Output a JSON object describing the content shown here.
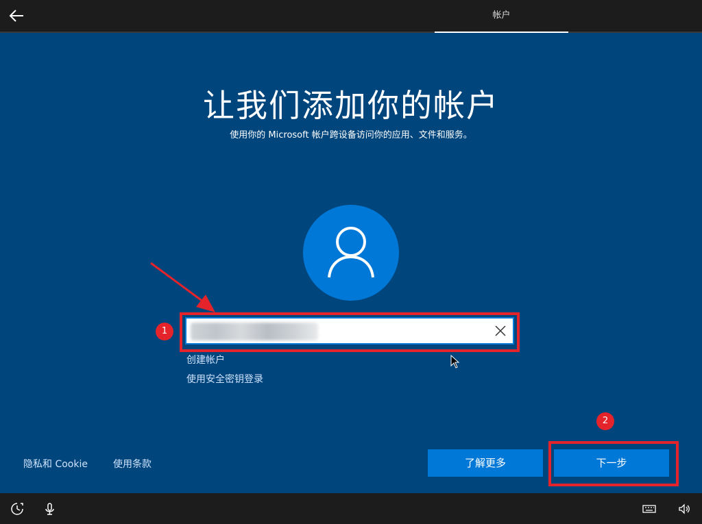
{
  "header": {
    "back_label": "←",
    "tab_account": "帐户"
  },
  "main": {
    "title": "让我们添加你的帐户",
    "subtitle": "使用你的 Microsoft 帐户跨设备访问你的应用、文件和服务。",
    "email_input": {
      "value": "",
      "placeholder": ""
    },
    "clear_icon": "close-icon",
    "link_create_account": "创建帐户",
    "link_security_key": "使用安全密钥登录"
  },
  "annotations": {
    "badge_1": "1",
    "badge_2": "2",
    "color": "#e4232b"
  },
  "footer": {
    "privacy_cookie": "隐私和 Cookie",
    "terms": "使用条款",
    "learn_more_button": "了解更多",
    "next_button": "下一步"
  },
  "taskbar": {
    "icons": [
      "ease-of-access-icon",
      "microphone-icon",
      "keyboard-icon",
      "volume-icon"
    ]
  },
  "colors": {
    "background": "#00457c",
    "accent": "#0078d7",
    "topbar": "#1c1c1c",
    "link": "#cfe4ff"
  }
}
